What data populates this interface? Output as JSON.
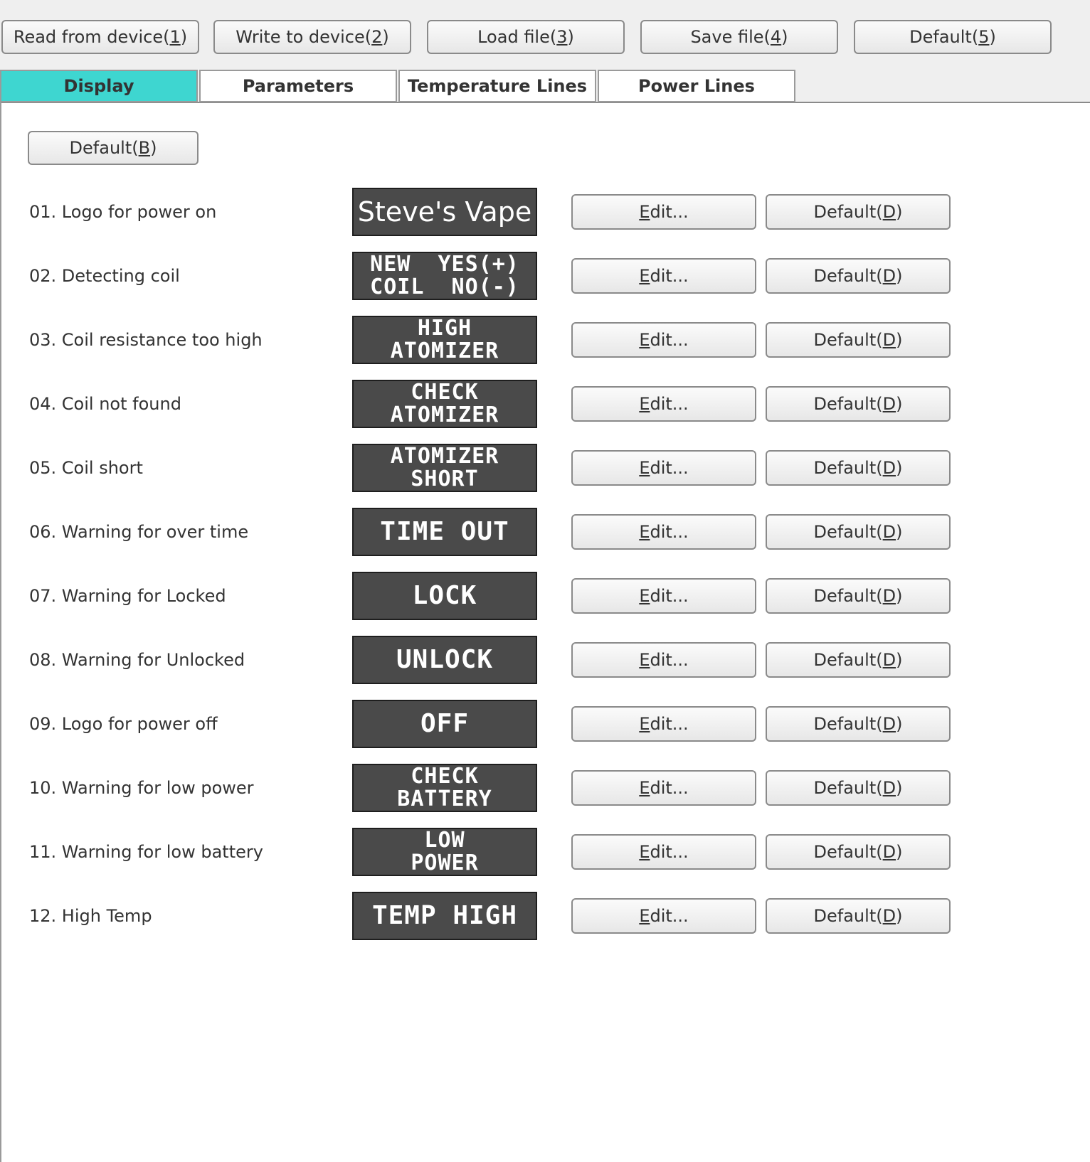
{
  "toolbar": {
    "read": {
      "text": "Read from device(",
      "key": "1",
      "tail": ")"
    },
    "write": {
      "text": "Write to device(",
      "key": "2",
      "tail": ")"
    },
    "load": {
      "text": "Load file(",
      "key": "3",
      "tail": ")"
    },
    "save": {
      "text": "Save file(",
      "key": "4",
      "tail": ")"
    },
    "default": {
      "text": "Default(",
      "key": "5",
      "tail": ")"
    }
  },
  "tabs": [
    {
      "label": "Display"
    },
    {
      "label": "Parameters"
    },
    {
      "label": "Temperature Lines"
    },
    {
      "label": "Power Lines"
    }
  ],
  "panel": {
    "default_all": {
      "text": "Default(",
      "key": "B",
      "tail": ")"
    },
    "edit": {
      "key": "E",
      "text": "dit..."
    },
    "default_row": {
      "text": "Default(",
      "key": "D",
      "tail": ")"
    }
  },
  "rows": [
    {
      "label": "01. Logo for power on",
      "screen": [
        "Steve's Vape"
      ]
    },
    {
      "label": "02. Detecting coil",
      "screen": [
        "NEW  YES(+)",
        "COIL  NO(-)"
      ]
    },
    {
      "label": "03. Coil resistance too high",
      "screen": [
        "HIGH",
        "ATOMIZER"
      ]
    },
    {
      "label": "04. Coil not found",
      "screen": [
        "CHECK",
        "ATOMIZER"
      ]
    },
    {
      "label": "05. Coil short",
      "screen": [
        "ATOMIZER",
        "SHORT"
      ]
    },
    {
      "label": "06. Warning for over time",
      "screen": [
        "TIME OUT"
      ]
    },
    {
      "label": "07. Warning for Locked",
      "screen": [
        "LOCK"
      ]
    },
    {
      "label": "08. Warning for Unlocked",
      "screen": [
        "UNLOCK"
      ]
    },
    {
      "label": "09. Logo for power off",
      "screen": [
        "OFF"
      ]
    },
    {
      "label": "10. Warning for low power",
      "screen": [
        "CHECK",
        "BATTERY"
      ]
    },
    {
      "label": "11. Warning for low battery",
      "screen": [
        "LOW",
        "POWER"
      ]
    },
    {
      "label": "12. High Temp",
      "screen": [
        "TEMP HIGH"
      ]
    }
  ],
  "colors": {
    "active_tab": "#3ed6d0",
    "screen_bg": "#4a4a4a",
    "screen_text": "#ffffff"
  }
}
